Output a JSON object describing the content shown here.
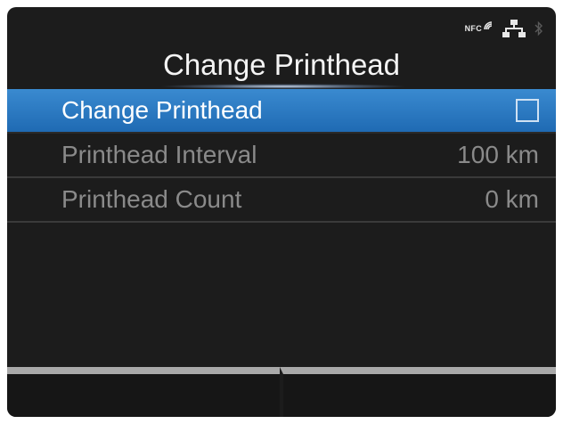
{
  "status": {
    "nfc_label": "NFC",
    "icons": [
      "nfc-icon",
      "network-icon",
      "bluetooth-icon"
    ]
  },
  "screen": {
    "title": "Change Printhead"
  },
  "menu": {
    "items": [
      {
        "label": "Change Printhead",
        "value": "",
        "control": "checkbox",
        "checked": false,
        "selected": true
      },
      {
        "label": "Printhead Interval",
        "value": "100 km",
        "selected": false
      },
      {
        "label": "Printhead Count",
        "value": "0 km",
        "selected": false
      }
    ]
  },
  "softkeys": {
    "left_label": "",
    "right_label": ""
  },
  "colors": {
    "selection": "#2b7bc6",
    "background": "#1c1c1c",
    "dim_text": "#8a8a8a"
  }
}
